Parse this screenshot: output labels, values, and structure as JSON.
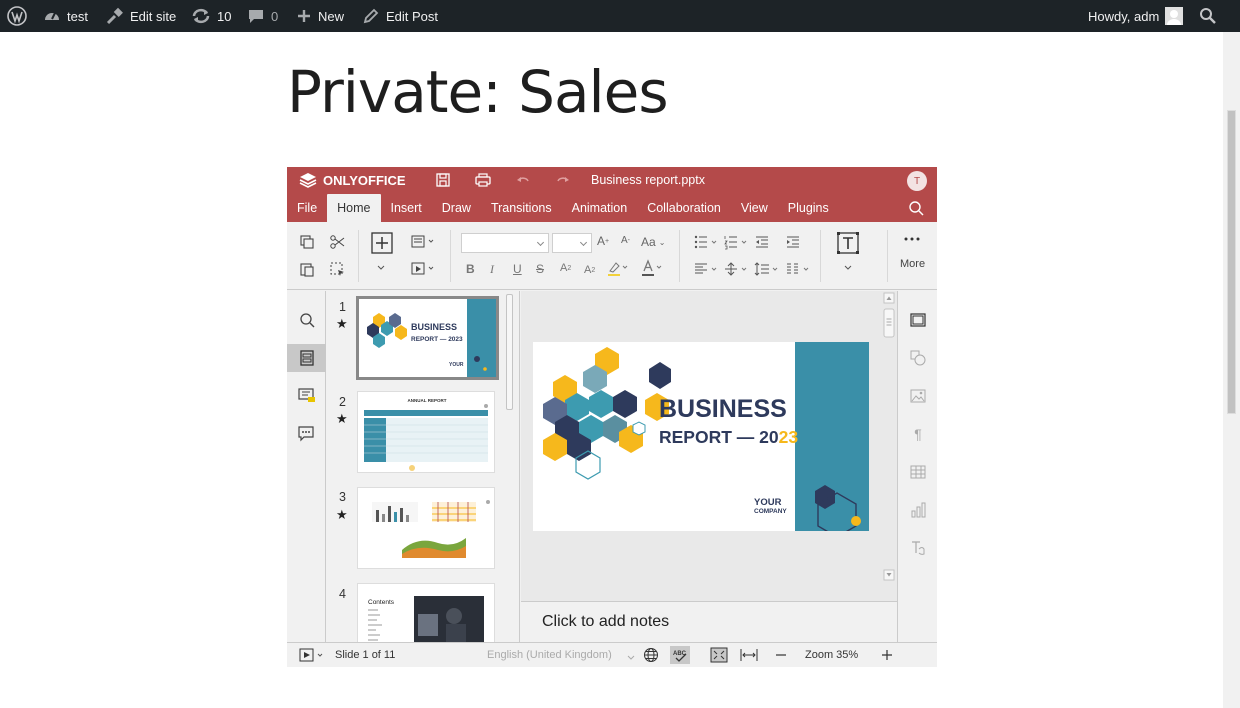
{
  "adminbar": {
    "site_name": "test",
    "edit_site": "Edit site",
    "updates_count": "10",
    "comments_count": "0",
    "new_label": "New",
    "edit_post": "Edit Post",
    "howdy": "Howdy, adm"
  },
  "page": {
    "title": "Private: Sales"
  },
  "editor": {
    "brand": "ONLYOFFICE",
    "file_name": "Business report.pptx",
    "user_initial": "T",
    "tabs": [
      {
        "label": "File"
      },
      {
        "label": "Home",
        "active": true
      },
      {
        "label": "Insert"
      },
      {
        "label": "Draw"
      },
      {
        "label": "Transitions"
      },
      {
        "label": "Animation"
      },
      {
        "label": "Collaboration"
      },
      {
        "label": "View"
      },
      {
        "label": "Plugins"
      }
    ],
    "ribbon": {
      "more_label": "More"
    },
    "thumbnails": [
      {
        "number": "1",
        "star": "★",
        "title": "BUSINESS",
        "subtitle": "REPORT — 2023",
        "company": "YOUR"
      },
      {
        "number": "2",
        "star": "★",
        "title": "ANNUAL REPORT"
      },
      {
        "number": "3",
        "star": "★"
      },
      {
        "number": "4",
        "heading": "Contents"
      }
    ],
    "slide": {
      "title": "BUSINESS",
      "subtitle_prefix": "REPORT — 20",
      "subtitle_accent": "23",
      "company_line1": "YOUR",
      "company_line2": "COMPANY"
    },
    "notes_placeholder": "Click to add notes",
    "status": {
      "slide_info": "Slide 1 of 11",
      "language": "English (United Kingdom)",
      "zoom": "Zoom 35%"
    },
    "colors": {
      "header": "#b44a4a",
      "slide_teal": "#3a8fa8",
      "hex_yellow": "#f6b81c",
      "hex_navy": "#2e3a5c",
      "hex_teal": "#3d9bb0"
    }
  }
}
